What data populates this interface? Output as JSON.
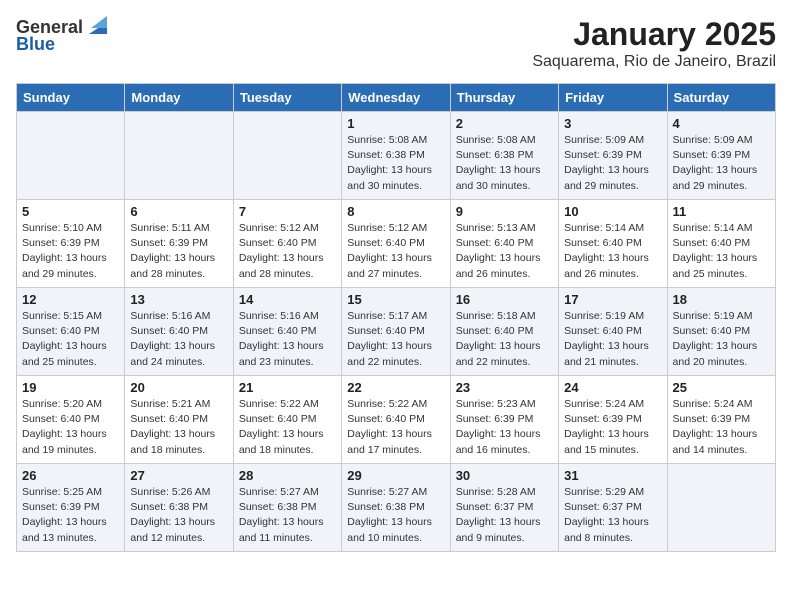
{
  "logo": {
    "text_general": "General",
    "text_blue": "Blue"
  },
  "title": "January 2025",
  "subtitle": "Saquarema, Rio de Janeiro, Brazil",
  "days_of_week": [
    "Sunday",
    "Monday",
    "Tuesday",
    "Wednesday",
    "Thursday",
    "Friday",
    "Saturday"
  ],
  "weeks": [
    [
      {
        "day": "",
        "info": ""
      },
      {
        "day": "",
        "info": ""
      },
      {
        "day": "",
        "info": ""
      },
      {
        "day": "1",
        "info": "Sunrise: 5:08 AM\nSunset: 6:38 PM\nDaylight: 13 hours\nand 30 minutes."
      },
      {
        "day": "2",
        "info": "Sunrise: 5:08 AM\nSunset: 6:38 PM\nDaylight: 13 hours\nand 30 minutes."
      },
      {
        "day": "3",
        "info": "Sunrise: 5:09 AM\nSunset: 6:39 PM\nDaylight: 13 hours\nand 29 minutes."
      },
      {
        "day": "4",
        "info": "Sunrise: 5:09 AM\nSunset: 6:39 PM\nDaylight: 13 hours\nand 29 minutes."
      }
    ],
    [
      {
        "day": "5",
        "info": "Sunrise: 5:10 AM\nSunset: 6:39 PM\nDaylight: 13 hours\nand 29 minutes."
      },
      {
        "day": "6",
        "info": "Sunrise: 5:11 AM\nSunset: 6:39 PM\nDaylight: 13 hours\nand 28 minutes."
      },
      {
        "day": "7",
        "info": "Sunrise: 5:12 AM\nSunset: 6:40 PM\nDaylight: 13 hours\nand 28 minutes."
      },
      {
        "day": "8",
        "info": "Sunrise: 5:12 AM\nSunset: 6:40 PM\nDaylight: 13 hours\nand 27 minutes."
      },
      {
        "day": "9",
        "info": "Sunrise: 5:13 AM\nSunset: 6:40 PM\nDaylight: 13 hours\nand 26 minutes."
      },
      {
        "day": "10",
        "info": "Sunrise: 5:14 AM\nSunset: 6:40 PM\nDaylight: 13 hours\nand 26 minutes."
      },
      {
        "day": "11",
        "info": "Sunrise: 5:14 AM\nSunset: 6:40 PM\nDaylight: 13 hours\nand 25 minutes."
      }
    ],
    [
      {
        "day": "12",
        "info": "Sunrise: 5:15 AM\nSunset: 6:40 PM\nDaylight: 13 hours\nand 25 minutes."
      },
      {
        "day": "13",
        "info": "Sunrise: 5:16 AM\nSunset: 6:40 PM\nDaylight: 13 hours\nand 24 minutes."
      },
      {
        "day": "14",
        "info": "Sunrise: 5:16 AM\nSunset: 6:40 PM\nDaylight: 13 hours\nand 23 minutes."
      },
      {
        "day": "15",
        "info": "Sunrise: 5:17 AM\nSunset: 6:40 PM\nDaylight: 13 hours\nand 22 minutes."
      },
      {
        "day": "16",
        "info": "Sunrise: 5:18 AM\nSunset: 6:40 PM\nDaylight: 13 hours\nand 22 minutes."
      },
      {
        "day": "17",
        "info": "Sunrise: 5:19 AM\nSunset: 6:40 PM\nDaylight: 13 hours\nand 21 minutes."
      },
      {
        "day": "18",
        "info": "Sunrise: 5:19 AM\nSunset: 6:40 PM\nDaylight: 13 hours\nand 20 minutes."
      }
    ],
    [
      {
        "day": "19",
        "info": "Sunrise: 5:20 AM\nSunset: 6:40 PM\nDaylight: 13 hours\nand 19 minutes."
      },
      {
        "day": "20",
        "info": "Sunrise: 5:21 AM\nSunset: 6:40 PM\nDaylight: 13 hours\nand 18 minutes."
      },
      {
        "day": "21",
        "info": "Sunrise: 5:22 AM\nSunset: 6:40 PM\nDaylight: 13 hours\nand 18 minutes."
      },
      {
        "day": "22",
        "info": "Sunrise: 5:22 AM\nSunset: 6:40 PM\nDaylight: 13 hours\nand 17 minutes."
      },
      {
        "day": "23",
        "info": "Sunrise: 5:23 AM\nSunset: 6:39 PM\nDaylight: 13 hours\nand 16 minutes."
      },
      {
        "day": "24",
        "info": "Sunrise: 5:24 AM\nSunset: 6:39 PM\nDaylight: 13 hours\nand 15 minutes."
      },
      {
        "day": "25",
        "info": "Sunrise: 5:24 AM\nSunset: 6:39 PM\nDaylight: 13 hours\nand 14 minutes."
      }
    ],
    [
      {
        "day": "26",
        "info": "Sunrise: 5:25 AM\nSunset: 6:39 PM\nDaylight: 13 hours\nand 13 minutes."
      },
      {
        "day": "27",
        "info": "Sunrise: 5:26 AM\nSunset: 6:38 PM\nDaylight: 13 hours\nand 12 minutes."
      },
      {
        "day": "28",
        "info": "Sunrise: 5:27 AM\nSunset: 6:38 PM\nDaylight: 13 hours\nand 11 minutes."
      },
      {
        "day": "29",
        "info": "Sunrise: 5:27 AM\nSunset: 6:38 PM\nDaylight: 13 hours\nand 10 minutes."
      },
      {
        "day": "30",
        "info": "Sunrise: 5:28 AM\nSunset: 6:37 PM\nDaylight: 13 hours\nand 9 minutes."
      },
      {
        "day": "31",
        "info": "Sunrise: 5:29 AM\nSunset: 6:37 PM\nDaylight: 13 hours\nand 8 minutes."
      },
      {
        "day": "",
        "info": ""
      }
    ]
  ]
}
